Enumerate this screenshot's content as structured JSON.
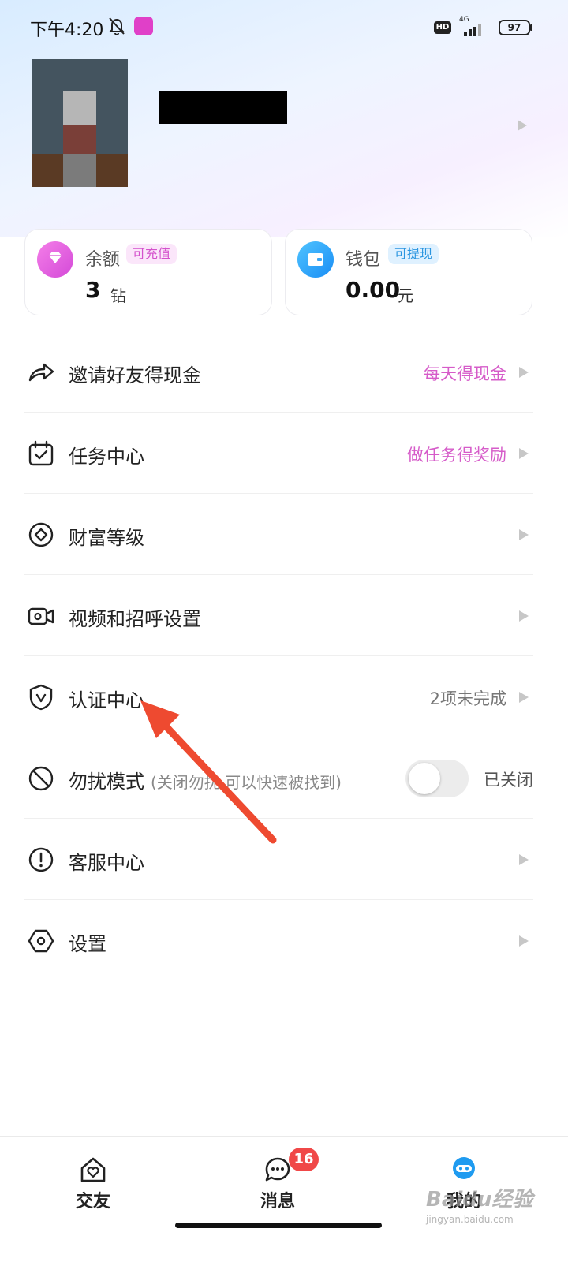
{
  "status_bar": {
    "time": "下午4:20",
    "hd": "HD",
    "network": "4G",
    "battery": "97"
  },
  "balance_card": {
    "title": "余额",
    "tag": "可充值",
    "value": "3",
    "unit": "钻"
  },
  "wallet_card": {
    "title": "钱包",
    "tag": "可提现",
    "value": "0.00",
    "unit": "元"
  },
  "menu": {
    "invite": {
      "label": "邀请好友得现金",
      "hint": "每天得现金"
    },
    "tasks": {
      "label": "任务中心",
      "hint": "做任务得奖励"
    },
    "wealth": {
      "label": "财富等级"
    },
    "video": {
      "label": "视频和招呼设置"
    },
    "verify": {
      "label": "认证中心",
      "hint": "2项未完成"
    },
    "dnd": {
      "label": "勿扰模式",
      "sub": "(关闭勿扰,可以快速被找到)",
      "state": "已关闭",
      "enabled": false
    },
    "service": {
      "label": "客服中心"
    },
    "settings": {
      "label": "设置"
    }
  },
  "bottom_nav": {
    "friends": "交友",
    "messages": "消息",
    "messages_badge": "16",
    "me": "我的"
  },
  "watermark": {
    "main": "Baidu经验",
    "sub": "jingyan.baidu.com"
  },
  "colors": {
    "accent_pink": "#d65cc9",
    "accent_blue": "#2a95e0",
    "badge_red": "#f04848",
    "annotation_red": "#ee4a30"
  }
}
